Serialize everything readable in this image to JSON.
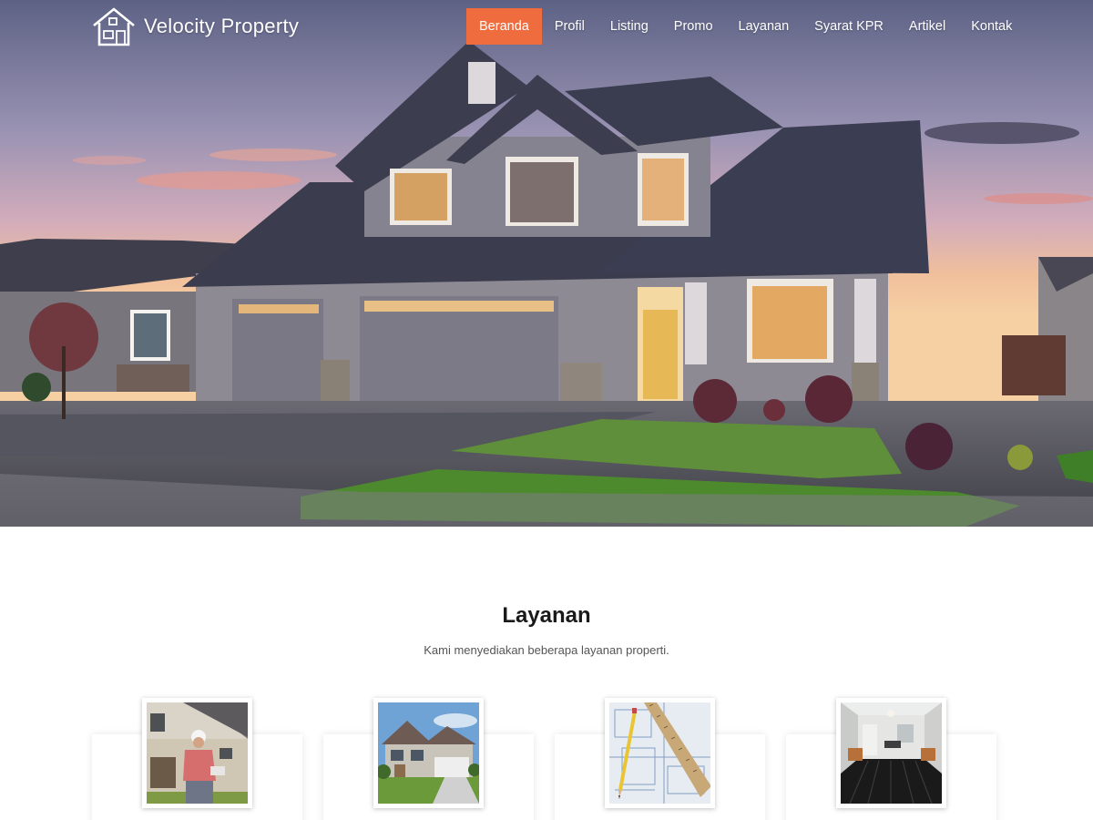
{
  "brand": {
    "name": "Velocity Property",
    "logo_icon": "house-logo-icon"
  },
  "nav": {
    "items": [
      {
        "label": "Beranda",
        "active": true
      },
      {
        "label": "Profil"
      },
      {
        "label": "Listing"
      },
      {
        "label": "Promo"
      },
      {
        "label": "Layanan"
      },
      {
        "label": "Syarat KPR"
      },
      {
        "label": "Artikel"
      },
      {
        "label": "Kontak"
      }
    ],
    "active_color": "#ef6c3e"
  },
  "hero": {
    "image": "suburban-house-at-dusk"
  },
  "services": {
    "title": "Layanan",
    "subtitle": "Kami menyediakan beberapa layanan properti.",
    "cards": [
      {
        "image": "construction-worker-photo"
      },
      {
        "image": "house-exterior-photo"
      },
      {
        "image": "blueprint-pencil-ruler-photo"
      },
      {
        "image": "interior-room-photo"
      }
    ]
  }
}
